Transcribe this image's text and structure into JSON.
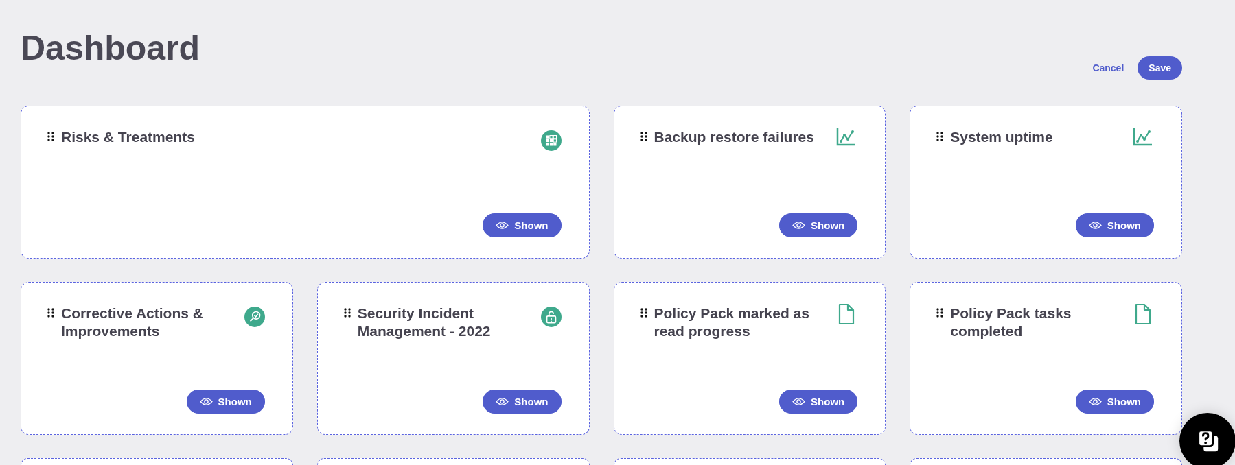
{
  "page": {
    "title": "Dashboard"
  },
  "actions": [
    {
      "label": "Cancel",
      "kind": "link"
    },
    {
      "label": "Save",
      "kind": "primary"
    }
  ],
  "widgets": [
    {
      "title": "Risks & Treatments",
      "kind": "matrix",
      "wide": true,
      "visibility": {
        "label": "Shown",
        "shown": true
      }
    },
    {
      "title": "Backup restore failures",
      "kind": "chart",
      "wide": false,
      "visibility": {
        "label": "Shown",
        "shown": true
      }
    },
    {
      "title": "System uptime",
      "kind": "chart",
      "wide": false,
      "visibility": {
        "label": "Shown",
        "shown": true
      }
    },
    {
      "title": "Corrective Actions & Improvements",
      "kind": "search-check",
      "wide": false,
      "visibility": {
        "label": "Shown",
        "shown": true
      }
    },
    {
      "title": "Security Incident Management - 2022",
      "kind": "unlock",
      "wide": false,
      "visibility": {
        "label": "Shown",
        "shown": true
      }
    },
    {
      "title": "Policy Pack marked as read progress",
      "kind": "document",
      "wide": false,
      "visibility": {
        "label": "Shown",
        "shown": true
      }
    },
    {
      "title": "Policy Pack tasks completed",
      "kind": "document",
      "wide": false,
      "visibility": {
        "label": "Shown",
        "shown": true
      }
    }
  ]
}
